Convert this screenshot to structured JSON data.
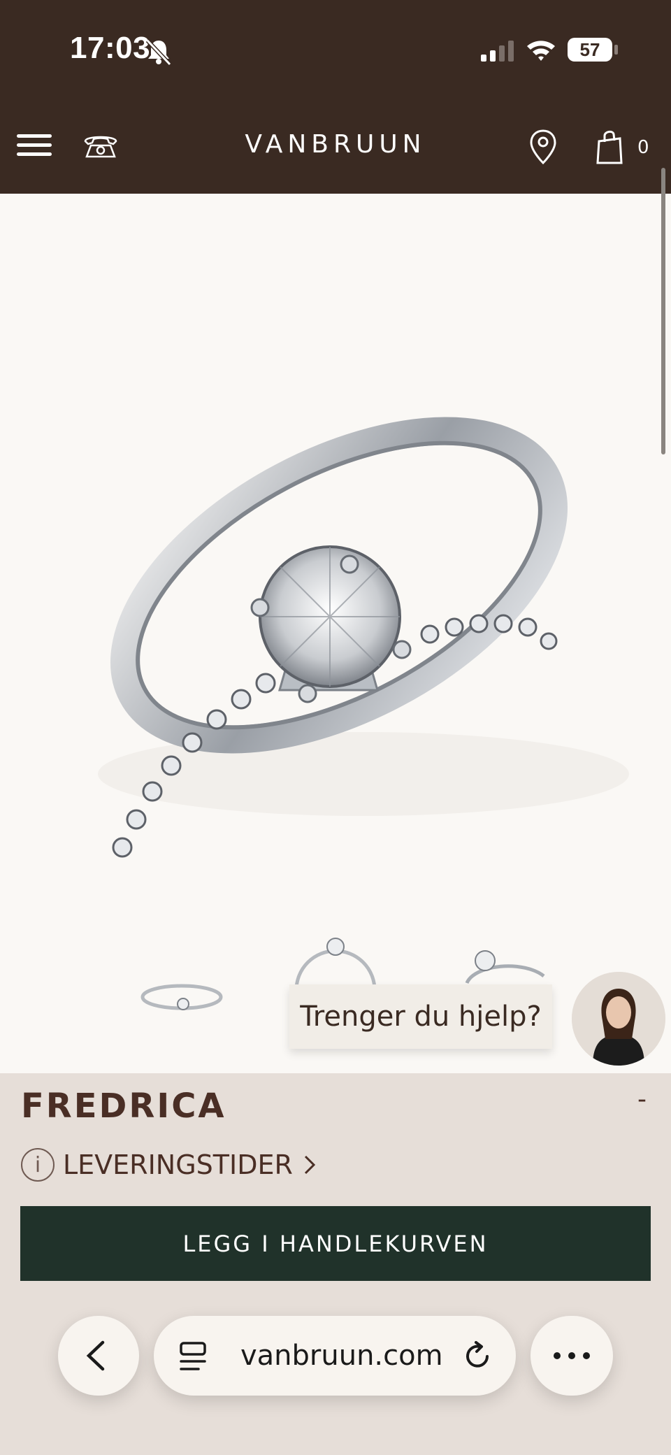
{
  "status_bar": {
    "time": "17:03",
    "battery": "57",
    "icons": [
      "bell-slash-icon",
      "signal-icon",
      "wifi-icon",
      "battery-icon"
    ]
  },
  "header": {
    "brand": "VANBRUUN",
    "cart_count": "0",
    "icons": [
      "menu-icon",
      "phone-icon",
      "location-pin-icon",
      "shopping-bag-icon"
    ]
  },
  "product": {
    "name": "FREDRICA",
    "collapse_symbol": "-",
    "delivery_label": "LEVERINGSTIDER",
    "add_to_cart": "LEGG I HANDLEKURVEN"
  },
  "chat": {
    "prompt": "Trenger du hjelp?"
  },
  "browser": {
    "url": "vanbruun.com"
  },
  "colors": {
    "header_bg": "#3a2a22",
    "panel_bg": "#e6ded8",
    "cta_bg": "#20322a",
    "text_brown": "#4a2e25"
  }
}
